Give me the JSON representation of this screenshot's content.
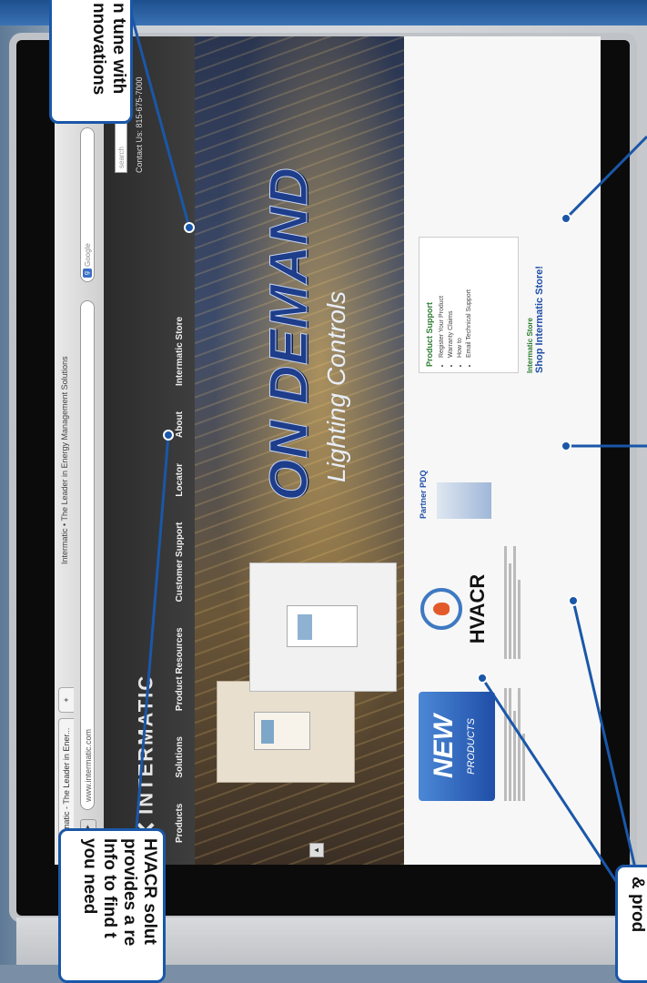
{
  "browser": {
    "tabs": [
      "Intermatic - The Leader in Ener...",
      "+"
    ],
    "window_title": "Intermatic • The Leader in Energy Management Solutions",
    "url": "www.intermatic.com",
    "search_placeholder": "Google"
  },
  "site": {
    "logo": "INTERMATIC",
    "nav": [
      "Products",
      "Solutions",
      "Product Resources",
      "Customer Support",
      "Locator",
      "About",
      "Intermatic Store"
    ],
    "search_placeholder": "search",
    "phone": "Contact Us: 815-675-7000",
    "hero": {
      "title": "ON DEMAND",
      "subtitle": "Lighting Controls"
    },
    "new_products": {
      "line1": "NEW",
      "line2": "PRODUCTS"
    },
    "hvacr": "HVACR",
    "partner": "Partner PDQ",
    "support": {
      "title": "Product Support",
      "items": [
        "Register Your Product",
        "Warranty Claims",
        "How to",
        "Email Technical Support"
      ]
    },
    "store": {
      "label": "Intermatic Store",
      "link": "Shop Intermatic Store!"
    }
  },
  "callouts": {
    "top_left": [
      "n tune with",
      "nnovations"
    ],
    "bottom_left": [
      "HVACR solut",
      "provides a re",
      "Info to find t",
      "you need"
    ],
    "bottom_right": [
      "& prod"
    ]
  }
}
